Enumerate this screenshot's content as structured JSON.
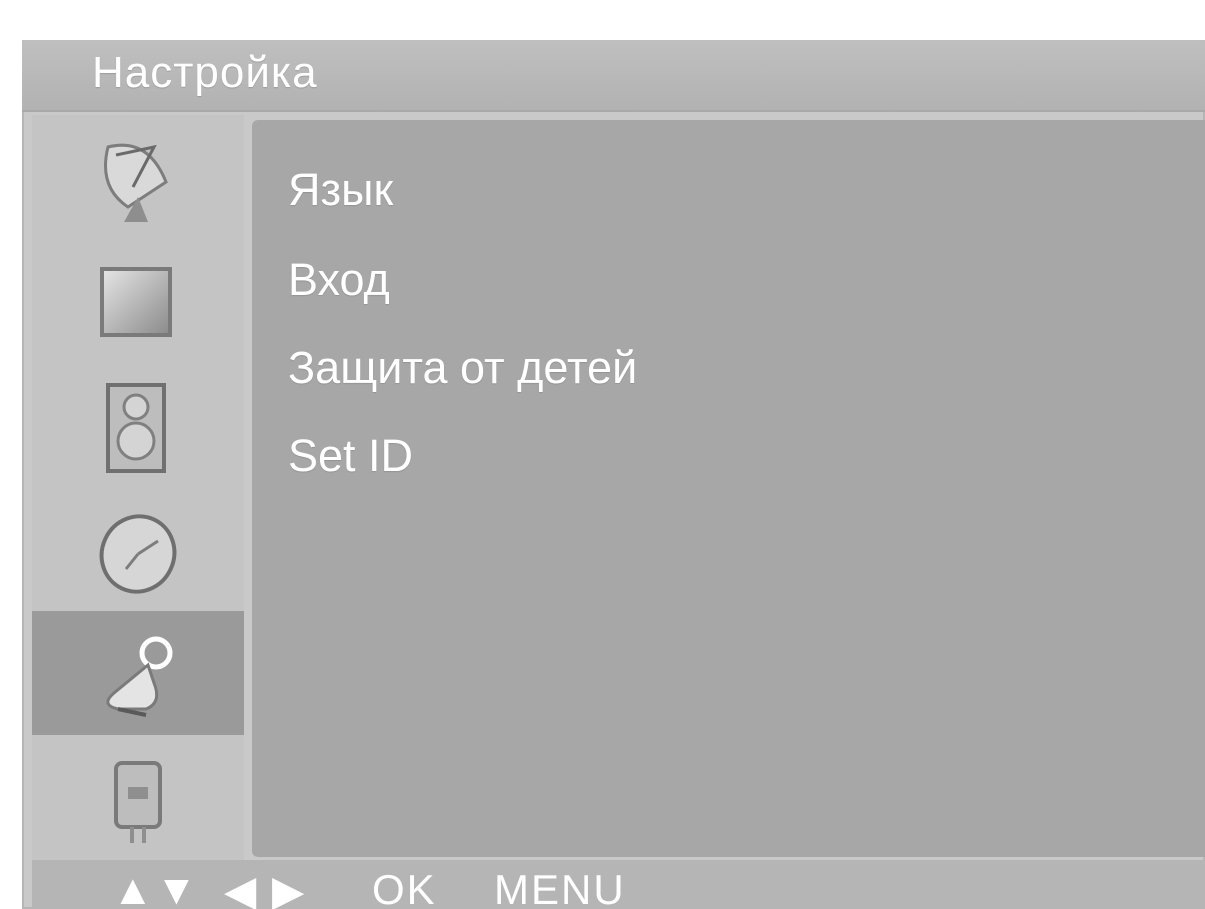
{
  "header": {
    "title": "Настройка"
  },
  "sidebar": {
    "items": [
      {
        "icon": "satellite-dish-icon"
      },
      {
        "icon": "picture-icon"
      },
      {
        "icon": "speaker-icon"
      },
      {
        "icon": "clock-icon"
      },
      {
        "icon": "wrench-icon",
        "selected": true
      },
      {
        "icon": "input-plug-icon"
      }
    ]
  },
  "menu": {
    "items": [
      {
        "label": "Язык"
      },
      {
        "label": "Вход"
      },
      {
        "label": "Защита от детей"
      },
      {
        "label": "Set ID"
      }
    ]
  },
  "footer": {
    "updown": "▲▼",
    "leftright": "◀ ▶",
    "ok": "OK",
    "menu": "MENU"
  },
  "colors": {
    "panel": "#c9c9c9",
    "content": "#a7a7a7",
    "selected": "#9a9a9a",
    "text": "#ffffff"
  }
}
